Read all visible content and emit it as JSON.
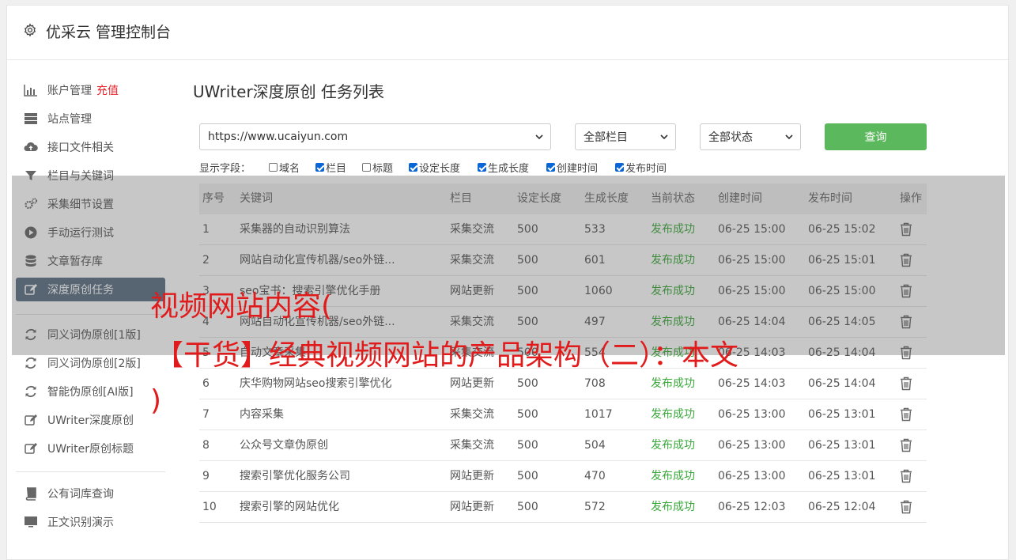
{
  "header": {
    "title": "优采云 管理控制台",
    "icon": "gear-icon"
  },
  "sidebar": {
    "items": [
      {
        "label": "账户管理",
        "badge": "充值",
        "icon": "bar-chart-icon"
      },
      {
        "label": "站点管理",
        "icon": "server-icon"
      },
      {
        "label": "接口文件相关",
        "icon": "cloud-upload-icon"
      },
      {
        "label": "栏目与关键词",
        "icon": "filter-icon"
      },
      {
        "label": "采集细节设置",
        "icon": "cogs-icon"
      },
      {
        "label": "手动运行测试",
        "icon": "play-circle-icon"
      },
      {
        "label": "文章暂存库",
        "icon": "database-icon"
      },
      {
        "label": "深度原创任务",
        "icon": "edit-icon"
      },
      {
        "label": "同义词伪原创[1版]",
        "icon": "refresh-icon"
      },
      {
        "label": "同义词伪原创[2版]",
        "icon": "refresh-icon"
      },
      {
        "label": "智能伪原创[AI版]",
        "icon": "refresh-icon"
      },
      {
        "label": "UWriter深度原创",
        "icon": "edit-icon"
      },
      {
        "label": "UWriter原创标题",
        "icon": "edit-icon"
      },
      {
        "label": "公有词库查询",
        "icon": "book-icon"
      },
      {
        "label": "正文识别演示",
        "icon": "monitor-icon"
      }
    ]
  },
  "main": {
    "title": "UWriter深度原创 任务列表",
    "filters": {
      "site": "https://www.ucaiyun.com",
      "column": "全部栏目",
      "status": "全部状态",
      "query_label": "查询"
    },
    "fields_label": "显示字段：",
    "fields": [
      {
        "label": "域名",
        "checked": false
      },
      {
        "label": "栏目",
        "checked": true
      },
      {
        "label": "标题",
        "checked": false
      },
      {
        "label": "设定长度",
        "checked": true
      },
      {
        "label": "生成长度",
        "checked": true
      },
      {
        "label": "创建时间",
        "checked": true
      },
      {
        "label": "发布时间",
        "checked": true
      }
    ],
    "table": {
      "headers": [
        "序号",
        "关键词",
        "栏目",
        "设定长度",
        "生成长度",
        "当前状态",
        "创建时间",
        "发布时间",
        "操作"
      ],
      "rows": [
        [
          "1",
          "采集器的自动识别算法",
          "采集交流",
          "500",
          "533",
          "发布成功",
          "06-25 15:00",
          "06-25 15:02"
        ],
        [
          "2",
          "网站自动化宣传机器/seo外链...",
          "采集交流",
          "500",
          "601",
          "发布成功",
          "06-25 15:00",
          "06-25 15:01"
        ],
        [
          "3",
          "seo宝书：搜索引擎优化手册",
          "网站更新",
          "500",
          "1060",
          "发布成功",
          "06-25 15:00",
          "06-25 15:00"
        ],
        [
          "4",
          "网站自动化宣传机器/seo外链...",
          "采集交流",
          "500",
          "497",
          "发布成功",
          "06-25 14:04",
          "06-25 14:05"
        ],
        [
          "5",
          "自动文章采集",
          "采集交流",
          "500",
          "554",
          "发布成功",
          "06-25 14:03",
          "06-25 14:04"
        ],
        [
          "6",
          "庆华购物网站seo搜索引擎优化",
          "网站更新",
          "500",
          "708",
          "发布成功",
          "06-25 14:03",
          "06-25 14:04"
        ],
        [
          "7",
          "内容采集",
          "采集交流",
          "500",
          "1017",
          "发布成功",
          "06-25 13:00",
          "06-25 13:01"
        ],
        [
          "8",
          "公众号文章伪原创",
          "采集交流",
          "500",
          "504",
          "发布成功",
          "06-25 13:00",
          "06-25 13:01"
        ],
        [
          "9",
          "搜索引擎优化服务公司",
          "网站更新",
          "500",
          "470",
          "发布成功",
          "06-25 13:00",
          "06-25 13:01"
        ],
        [
          "10",
          "搜索引擎的网站优化",
          "网站更新",
          "500",
          "572",
          "发布成功",
          "06-25 12:03",
          "06-25 12:04"
        ]
      ]
    }
  },
  "watermark": {
    "line1": "视频网站内容(",
    "line2": "【干货】经典视频网站的产品架构（二）：本文",
    "line3": ")"
  },
  "colors": {
    "active_nav": "#5a6d82",
    "query_button": "#5cb85c",
    "status_success": "#3aa83a",
    "charge_badge": "#e6252c",
    "watermark": "#e11b1b"
  }
}
